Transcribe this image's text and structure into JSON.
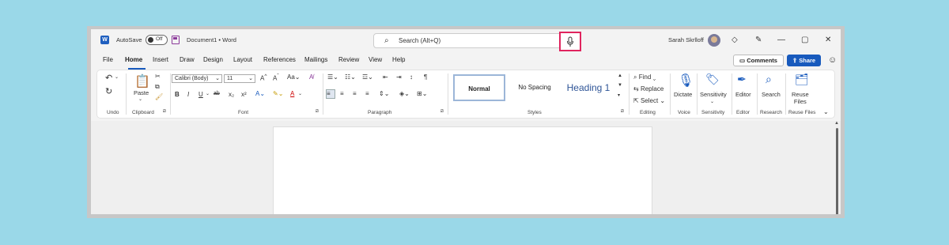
{
  "titlebar": {
    "app_logo": "W",
    "autosave_label": "AutoSave",
    "autosave_state": "Off",
    "document_title": "Document1 • Word",
    "search_placeholder": "Search (Alt+Q)",
    "user_name": "Sarah Skrlloff"
  },
  "menu": {
    "tabs": [
      "File",
      "Home",
      "Insert",
      "Draw",
      "Design",
      "Layout",
      "References",
      "Mailings",
      "Review",
      "View",
      "Help"
    ],
    "active": "Home",
    "comments_label": "Comments",
    "share_label": "Share"
  },
  "ribbon": {
    "undo_label": "Undo",
    "clipboard_label": "Clipboard",
    "paste_label": "Paste",
    "font_label": "Font",
    "font_name": "Calibri (Body)",
    "font_size": "11",
    "paragraph_label": "Paragraph",
    "styles_label": "Styles",
    "styles": [
      "Normal",
      "No Spacing",
      "Heading 1"
    ],
    "editing_label": "Editing",
    "find_label": "Find",
    "replace_label": "Replace",
    "select_label": "Select",
    "voice_label": "Voice",
    "dictate_label": "Dictate",
    "sensitivity_group": "Sensitivity",
    "sensitivity_label": "Sensitivity",
    "editor_group": "Editor",
    "editor_label": "Editor",
    "research_group": "Research",
    "search_label": "Search",
    "reuse_group": "Reuse Files",
    "reuse_label_1": "Reuse",
    "reuse_label_2": "Files"
  },
  "colors": {
    "accent": "#185abd",
    "highlight_box": "#e0245e",
    "background": "#9ad8e8"
  }
}
